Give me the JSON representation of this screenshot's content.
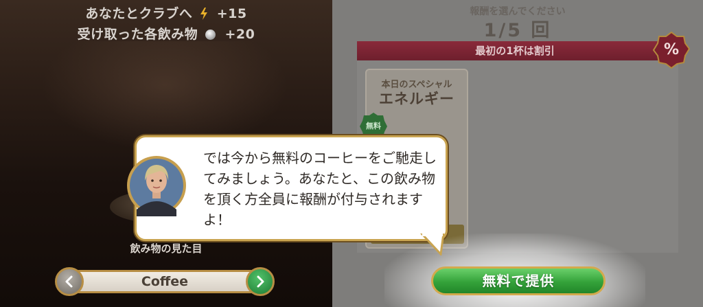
{
  "left": {
    "club_line": {
      "label": "あなたとクラブへ",
      "amount": "+15",
      "icon": "energy-bolt-icon"
    },
    "drinks_line": {
      "label": "受け取った各飲み物",
      "amount": "+20",
      "icon": "silver-coin-icon"
    },
    "looks_label": "飲み物の見た目",
    "selector": {
      "value": "Coffee",
      "prev_icon": "chevron-left-icon",
      "next_icon": "chevron-right-icon"
    }
  },
  "right": {
    "reward_prompt": "報酬を選んでください",
    "reward_count": "1/5 回",
    "discount_banner": "最初の1杯は割引",
    "percent_badge": "%",
    "special_card": {
      "subtitle": "本日のスペシャル",
      "title": "エネルギー",
      "free_badge": "無料"
    },
    "serve_button": "無料で提供"
  },
  "dialog": {
    "text": "では今から無料のコーヒーをご馳走してみましょう。あなたと、この飲み物を頂く方全員に報酬が付与されますよ！",
    "portrait": "hostess-portrait"
  },
  "colors": {
    "accent_gold": "#c9a451",
    "serve_green": "#34a23a",
    "banner_red": "#7a2533"
  }
}
